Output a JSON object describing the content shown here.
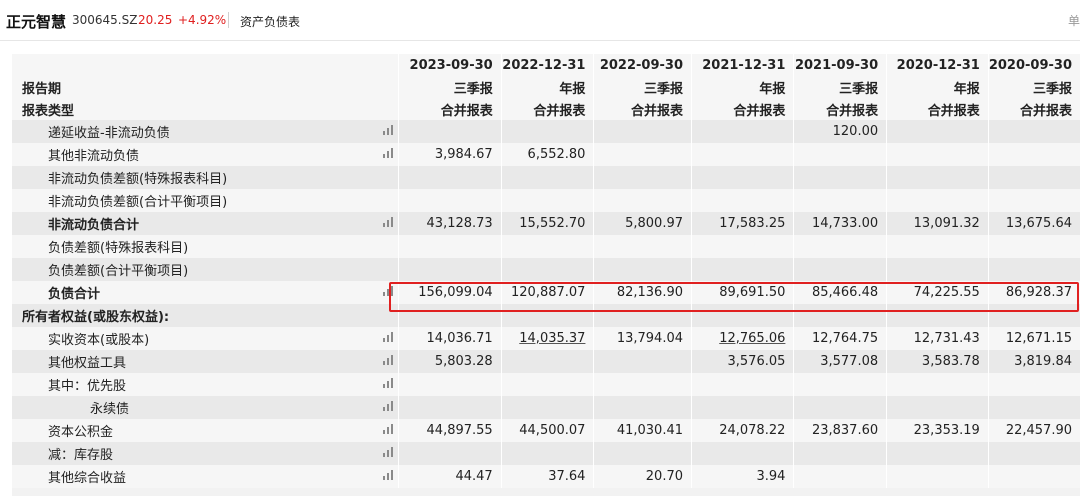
{
  "header": {
    "stock_name": "正元智慧",
    "stock_code": "300645.SZ",
    "price": "20.25",
    "change": "+4.92%",
    "sheet_title": "资产负债表",
    "edge_char": "单"
  },
  "columns": [
    {
      "date": "2023-09-30",
      "report": "三季报",
      "type": "合并报表"
    },
    {
      "date": "2022-12-31",
      "report": "年报",
      "type": "合并报表"
    },
    {
      "date": "2022-09-30",
      "report": "三季报",
      "type": "合并报表"
    },
    {
      "date": "2021-12-31",
      "report": "年报",
      "type": "合并报表"
    },
    {
      "date": "2021-09-30",
      "report": "三季报",
      "type": "合并报表"
    },
    {
      "date": "2020-12-31",
      "report": "年报",
      "type": "合并报表"
    },
    {
      "date": "2020-09-30",
      "report": "三季报",
      "type": "合并报表"
    }
  ],
  "labels": {
    "period": "报告期",
    "report_type": "报表类型"
  },
  "rows": [
    {
      "label": "递延收益-非流动负债",
      "values": [
        "",
        "",
        "",
        "",
        "120.00",
        "",
        ""
      ]
    },
    {
      "label": "其他非流动负债",
      "values": [
        "3,984.67",
        "6,552.80",
        "",
        "",
        "",
        "",
        ""
      ]
    },
    {
      "label": "非流动负债差额(特殊报表科目)",
      "values": [
        "",
        "",
        "",
        "",
        "",
        "",
        ""
      ]
    },
    {
      "label": "非流动负债差额(合计平衡项目)",
      "values": [
        "",
        "",
        "",
        "",
        "",
        "",
        ""
      ]
    },
    {
      "label": "非流动负债合计",
      "values": [
        "43,128.73",
        "15,552.70",
        "5,800.97",
        "17,583.25",
        "14,733.00",
        "13,091.32",
        "13,675.64"
      ]
    },
    {
      "label": "负债差额(特殊报表科目)",
      "values": [
        "",
        "",
        "",
        "",
        "",
        "",
        ""
      ]
    },
    {
      "label": "负债差额(合计平衡项目)",
      "values": [
        "",
        "",
        "",
        "",
        "",
        "",
        ""
      ]
    },
    {
      "label": "负债合计",
      "values": [
        "156,099.04",
        "120,887.07",
        "82,136.90",
        "89,691.50",
        "85,466.48",
        "74,225.55",
        "86,928.37"
      ]
    },
    {
      "label": "所有者权益(或股东权益):",
      "values": [
        "",
        "",
        "",
        "",
        "",
        "",
        ""
      ]
    },
    {
      "label": "实收资本(或股本)",
      "values": [
        "14,036.71",
        "14,035.37",
        "13,794.04",
        "12,765.06",
        "12,764.75",
        "12,731.43",
        "12,671.15"
      ]
    },
    {
      "label": "其他权益工具",
      "values": [
        "5,803.28",
        "",
        "",
        "3,576.05",
        "3,577.08",
        "3,583.78",
        "3,819.84"
      ]
    },
    {
      "label": "其中：优先股",
      "values": [
        "",
        "",
        "",
        "",
        "",
        "",
        ""
      ]
    },
    {
      "label": "永续债",
      "values": [
        "",
        "",
        "",
        "",
        "",
        "",
        ""
      ]
    },
    {
      "label": "资本公积金",
      "values": [
        "44,897.55",
        "44,500.07",
        "41,030.41",
        "24,078.22",
        "23,837.60",
        "23,353.19",
        "22,457.90"
      ]
    },
    {
      "label": "减：库存股",
      "values": [
        "",
        "",
        "",
        "",
        "",
        "",
        ""
      ]
    },
    {
      "label": "其他综合收益",
      "values": [
        "44.47",
        "37.64",
        "20.70",
        "3.94",
        "",
        "",
        ""
      ]
    }
  ]
}
